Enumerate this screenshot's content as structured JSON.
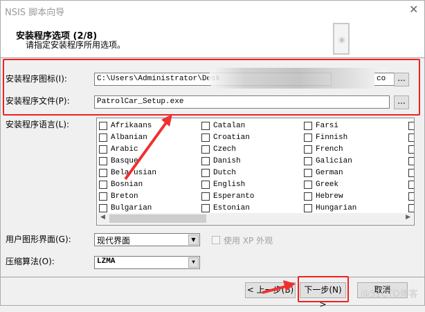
{
  "window": {
    "title": "NSIS 脚本向导",
    "close": "✕"
  },
  "header": {
    "title": "安装程序选项 (2/8)",
    "subtitle": "请指定安装程序所用选项。"
  },
  "icon_field": {
    "label": "安装程序图标(I):",
    "value": "C:\\Users\\Administrator\\Desk",
    "value_end": "co",
    "browse": "..."
  },
  "file_field": {
    "label": "安装程序文件(P):",
    "value": "PatrolCar_Setup.exe",
    "browse": "..."
  },
  "languages": {
    "label": "安装程序语言(L):",
    "columns": [
      [
        "Afrikaans",
        "Albanian",
        "Arabic",
        "Basque",
        "Belarusian",
        "Bosnian",
        "Breton",
        "Bulgarian"
      ],
      [
        "Catalan",
        "Croatian",
        "Czech",
        "Danish",
        "Dutch",
        "English",
        "Esperanto",
        "Estonian"
      ],
      [
        "Farsi",
        "Finnish",
        "French",
        "Galician",
        "German",
        "Greek",
        "Hebrew",
        "Hungarian"
      ]
    ]
  },
  "gui": {
    "label": "用户图形界面(G):",
    "value": "现代界面",
    "xp_label": "使用 XP 外观"
  },
  "compression": {
    "label": "压缩算法(O):",
    "value": "LZMA"
  },
  "buttons": {
    "back": "< 上一步(B)",
    "next": "下一步(N) >",
    "cancel": "取消"
  },
  "watermark": "@51CTO博客"
}
